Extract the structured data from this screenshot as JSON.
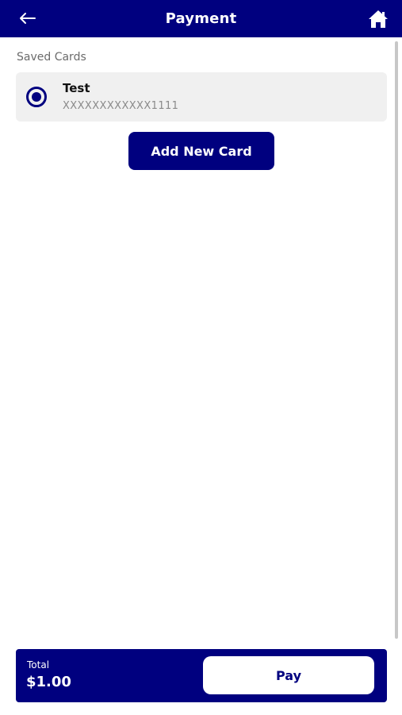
{
  "header": {
    "title": "Payment",
    "back_icon": "arrow-left-icon",
    "home_icon": "home-icon"
  },
  "saved_cards": {
    "section_label": "Saved Cards",
    "items": [
      {
        "name": "Test",
        "number": "XXXXXXXXXXXX1111",
        "selected": true
      }
    ]
  },
  "actions": {
    "add_card_label": "Add New Card"
  },
  "footer": {
    "total_label": "Total",
    "total_amount": "$1.00",
    "pay_label": "Pay"
  },
  "colors": {
    "primary": "#00007f",
    "card_background": "#f0f0f0",
    "muted_text": "#8a8a8a"
  }
}
